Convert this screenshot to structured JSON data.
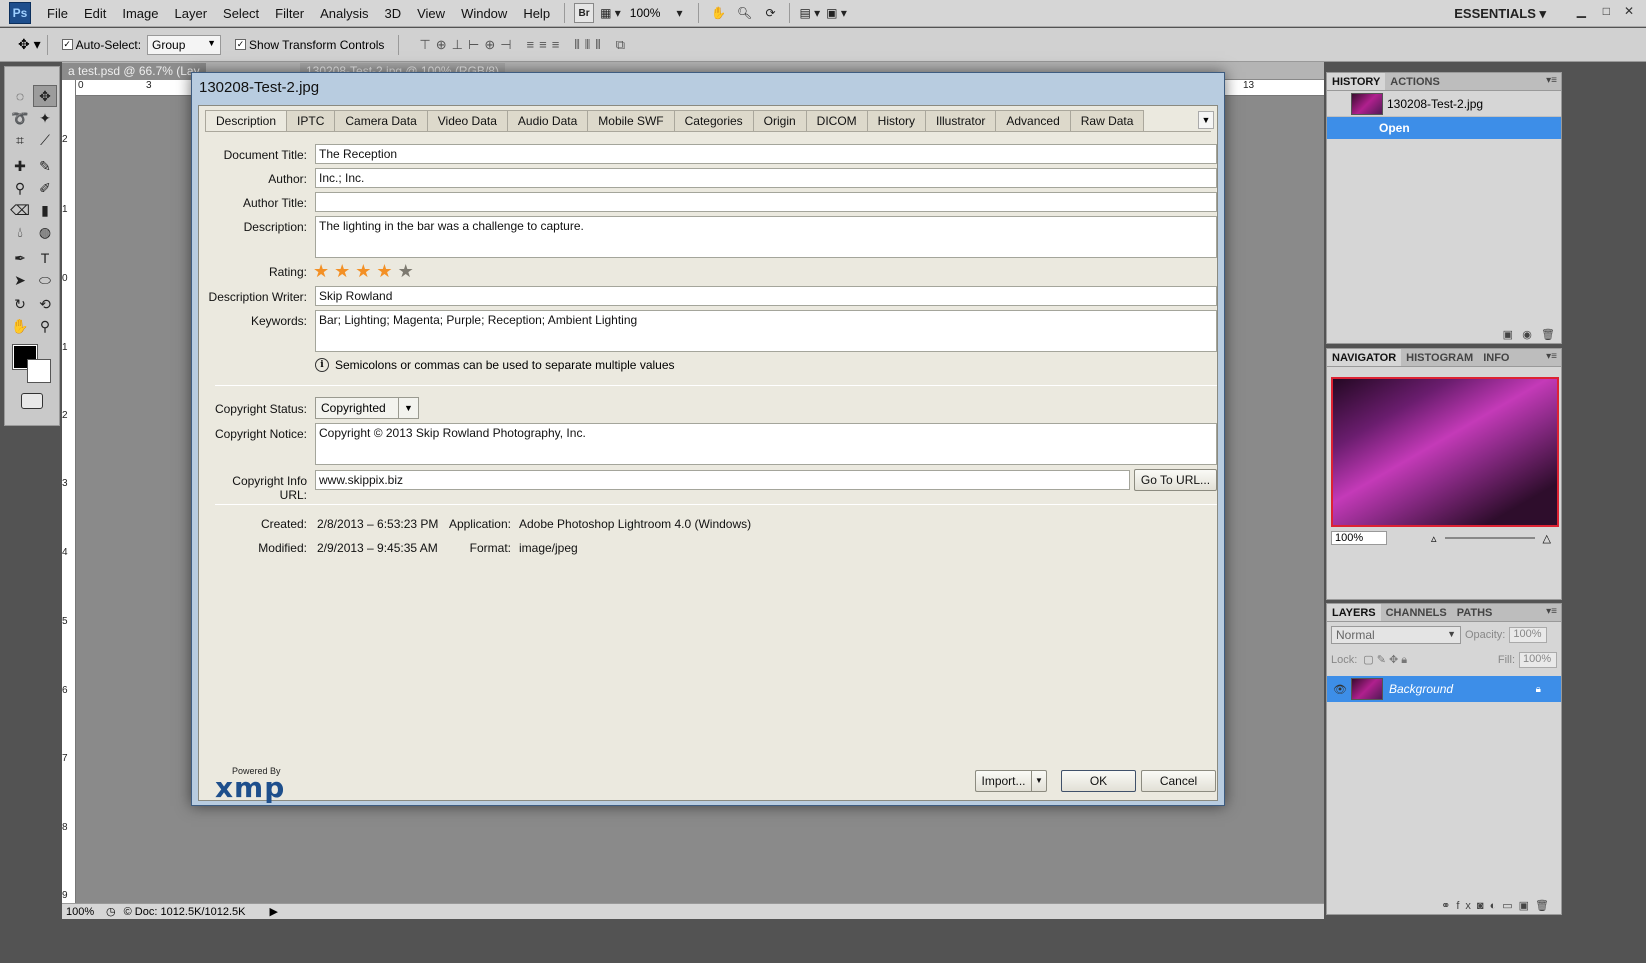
{
  "app": {
    "logo": "Ps",
    "menus": [
      "File",
      "Edit",
      "Image",
      "Layer",
      "Select",
      "Filter",
      "Analysis",
      "3D",
      "View",
      "Window",
      "Help"
    ],
    "bridge_label": "Br",
    "zoom": "100%",
    "workspace": "ESSENTIALS"
  },
  "options": {
    "auto_select_label": "Auto-Select:",
    "auto_select_value": "Group",
    "show_transform_label": "Show Transform Controls"
  },
  "document": {
    "tab1": "a test.psd @ 66.7% (Lay",
    "tab2": "130208-Test-2.jpg @ 100% (RGB/8)",
    "status_zoom": "100%",
    "status_doc": "Doc: 1012.5K/1012.5K",
    "ruler_h": [
      "0",
      "3",
      "13"
    ],
    "ruler_v": [
      "2",
      "1",
      "0",
      "1",
      "2",
      "3",
      "4",
      "5",
      "6",
      "7",
      "8",
      "9"
    ]
  },
  "dialog": {
    "title": "130208-Test-2.jpg",
    "tabs": [
      "Description",
      "IPTC",
      "Camera Data",
      "Video Data",
      "Audio Data",
      "Mobile SWF",
      "Categories",
      "Origin",
      "DICOM",
      "History",
      "Illustrator",
      "Advanced",
      "Raw Data"
    ],
    "labels": {
      "document_title": "Document Title:",
      "author": "Author:",
      "author_title": "Author Title:",
      "description": "Description:",
      "rating": "Rating:",
      "description_writer": "Description Writer:",
      "keywords": "Keywords:",
      "copyright_status": "Copyright Status:",
      "copyright_notice": "Copyright Notice:",
      "copyright_url": "Copyright Info URL:",
      "created": "Created:",
      "modified": "Modified:",
      "application": "Application:",
      "format": "Format:"
    },
    "values": {
      "document_title": "The Reception",
      "author": "Inc.; Inc.",
      "author_title": "",
      "description": "The lighting in the bar was a challenge to capture.",
      "rating": 4,
      "rating_max": 5,
      "description_writer": "Skip Rowland",
      "keywords": "Bar; Lighting; Magenta; Purple; Reception; Ambient Lighting",
      "copyright_status": "Copyrighted",
      "copyright_notice": "Copyright © 2013 Skip Rowland Photography, Inc.",
      "copyright_url": "www.skippix.biz",
      "created": "2/8/2013 – 6:53:23 PM",
      "modified": "2/9/2013 – 9:45:35 AM",
      "application": "Adobe Photoshop Lightroom 4.0 (Windows)",
      "format": "image/jpeg"
    },
    "hint": "Semicolons or commas can be used to separate multiple values",
    "buttons": {
      "go_to_url": "Go To URL...",
      "import": "Import...",
      "ok": "OK",
      "cancel": "Cancel"
    },
    "powered_by": "Powered By",
    "xmp_logo": "xmp"
  },
  "panels": {
    "history_tabs": [
      "HISTORY",
      "ACTIONS"
    ],
    "history_snapshot": "130208-Test-2.jpg",
    "history_state": "Open",
    "navigator_tabs": [
      "NAVIGATOR",
      "HISTOGRAM",
      "INFO"
    ],
    "navigator_zoom": "100%",
    "layers_tabs": [
      "LAYERS",
      "CHANNELS",
      "PATHS"
    ],
    "blend_mode": "Normal",
    "opacity_label": "Opacity:",
    "opacity_value": "100%",
    "lock_label": "Lock:",
    "fill_label": "Fill:",
    "fill_value": "100%",
    "layer_name": "Background"
  }
}
